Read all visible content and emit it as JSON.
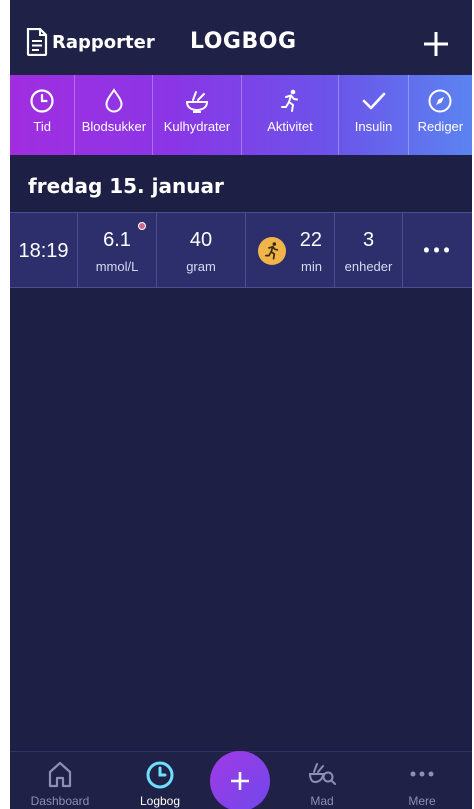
{
  "header": {
    "reports_label": "Rapporter",
    "title": "LOGBOG",
    "add_icon": "plus-icon"
  },
  "toolbar": {
    "items": [
      {
        "label": "Tid",
        "icon": "clock-icon"
      },
      {
        "label": "Blodsukker",
        "icon": "drop-icon"
      },
      {
        "label": "Kulhydrater",
        "icon": "bowl-icon"
      },
      {
        "label": "Aktivitet",
        "icon": "running-icon"
      },
      {
        "label": "Insulin",
        "icon": "check-icon"
      },
      {
        "label": "Rediger",
        "icon": "compass-icon"
      }
    ]
  },
  "day": {
    "heading": "fredag 15. januar",
    "entries": [
      {
        "time": "18:19",
        "glucose": {
          "value": "6.1",
          "unit": "mmol/L",
          "indicator_color": "#c96a8a"
        },
        "carbs": {
          "value": "40",
          "unit": "gram"
        },
        "activity": {
          "value": "22",
          "unit": "min",
          "badge_color": "#f0b44a"
        },
        "insulin": {
          "value": "3",
          "unit": "enheder"
        },
        "more": "•••"
      }
    ]
  },
  "bottom_nav": {
    "items": [
      {
        "label": "Dashboard",
        "icon": "home-icon",
        "active": false
      },
      {
        "label": "Logbog",
        "icon": "clock-icon",
        "active": true
      },
      {
        "label": "Mad",
        "icon": "food-search-icon",
        "active": false
      },
      {
        "label": "Mere",
        "icon": "more-icon",
        "active": false
      }
    ],
    "fab_icon": "plus-icon"
  },
  "colors": {
    "background": "#1d1f45",
    "row": "#2c2f6b",
    "toolbar_start": "#a12ee0",
    "toolbar_end": "#5b84f0",
    "active_nav": "#6ee0ff"
  }
}
